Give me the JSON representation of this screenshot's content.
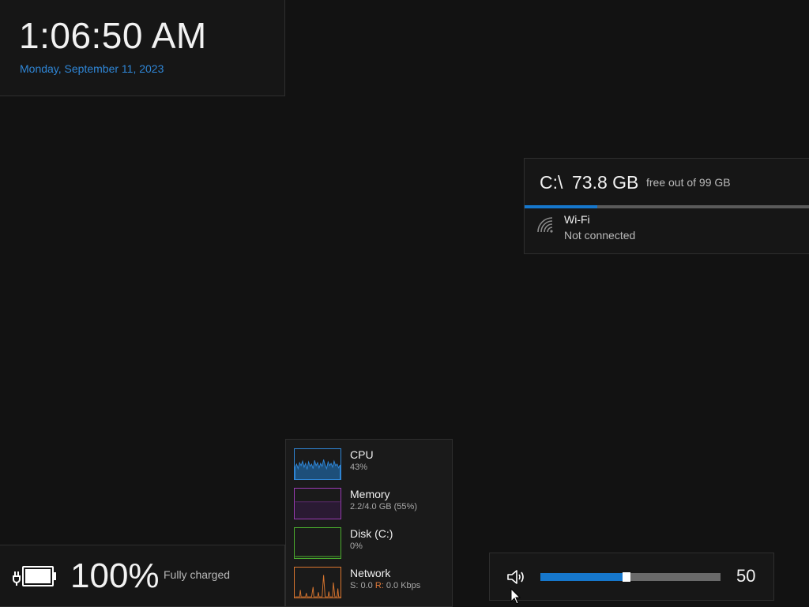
{
  "clock": {
    "time": "1:06:50 AM",
    "date": "Monday, September 11, 2023"
  },
  "drive": {
    "letter": "C:\\",
    "free": "73.8 GB",
    "suffix": "free out of 99 GB",
    "used_fraction": 0.255
  },
  "wifi": {
    "name": "Wi-Fi",
    "status": "Not connected",
    "icon": "wifi-icon"
  },
  "battery": {
    "percent": "100%",
    "status": "Fully charged",
    "icon": "battery-charging-icon"
  },
  "performance": {
    "cpu": {
      "name": "CPU",
      "value": "43%",
      "color": "#2f86d6"
    },
    "memory": {
      "name": "Memory",
      "value": "2.2/4.0 GB (55%)",
      "color": "#9b3bb5"
    },
    "disk": {
      "name": "Disk (C:)",
      "value": "0%",
      "color": "#4caf2f"
    },
    "network": {
      "name": "Network",
      "send_label": "S: 0.0",
      "recv_label": "R:",
      "recv_value": "0.0 Kbps",
      "color": "#d9762f"
    }
  },
  "volume": {
    "value": "50",
    "level": 0.5,
    "icon": "speaker-icon"
  },
  "colors": {
    "accent": "#1677cc",
    "background": "#121212"
  }
}
